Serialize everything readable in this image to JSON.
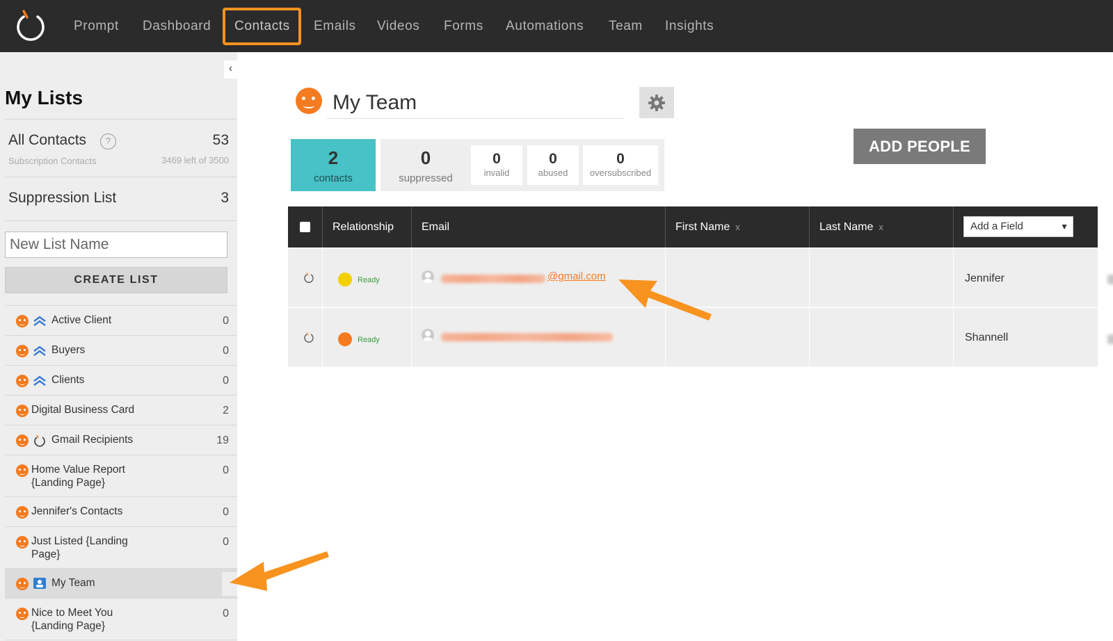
{
  "nav": {
    "items": [
      "Prompt",
      "Dashboard",
      "Contacts",
      "Emails",
      "Videos",
      "Forms",
      "Automations",
      "Team",
      "Insights"
    ],
    "active": "Contacts"
  },
  "sidebar": {
    "collapse_glyph": "‹",
    "heading": "My Lists",
    "all_contacts": {
      "label": "All Contacts",
      "count": "53",
      "sub_label": "Subscription Contacts",
      "sub_value": "3469 left of 3500"
    },
    "help_glyph": "?",
    "suppression": {
      "label": "Suppression List",
      "count": "3"
    },
    "new_list_placeholder": "New List Name",
    "create_button": "CREATE LIST",
    "lists": [
      {
        "label": "Active Client",
        "count": "0",
        "icon": "chevrons-up-icon"
      },
      {
        "label": "Buyers",
        "count": "0",
        "icon": "chevrons-up-icon"
      },
      {
        "label": "Clients",
        "count": "0",
        "icon": "chevrons-up-icon"
      },
      {
        "label": "Digital Business Card",
        "count": "2",
        "icon": ""
      },
      {
        "label": "Gmail Recipients",
        "count": "19",
        "icon": "refresh-icon"
      },
      {
        "label": "Home Value Report {Landing Page}",
        "count": "0",
        "icon": ""
      },
      {
        "label": "Jennifer's Contacts",
        "count": "0",
        "icon": ""
      },
      {
        "label": "Just Listed {Landing Page}",
        "count": "0",
        "icon": ""
      },
      {
        "label": "My Team",
        "count": "",
        "icon": "team-icon"
      },
      {
        "label": "Nice to Meet You {Landing Page}",
        "count": "0",
        "icon": ""
      }
    ]
  },
  "main": {
    "title": "My Team",
    "stats": {
      "contacts": {
        "value": "2",
        "label": "contacts"
      },
      "suppressed": {
        "value": "0",
        "label": "suppressed"
      },
      "invalid": {
        "value": "0",
        "label": "invalid"
      },
      "abused": {
        "value": "0",
        "label": "abused"
      },
      "oversubscribed": {
        "value": "0",
        "label": "oversubscribed"
      }
    },
    "add_people": "ADD PEOPLE",
    "table": {
      "headers": {
        "relationship": "Relationship",
        "email": "Email",
        "first_name": "First Name",
        "last_name": "Last Name"
      },
      "remove_glyph": "x",
      "add_field": "Add a Field",
      "rows": [
        {
          "status": "Ready",
          "email_suffix": "@gmail.com",
          "first_name": "Jennifer"
        },
        {
          "status": "Ready",
          "email_suffix": "",
          "first_name": "Shannell"
        }
      ]
    }
  },
  "colors": {
    "accent": "#f47b20",
    "teal": "#47c2c6",
    "highlight": "#f7931e",
    "nav_bg": "#2b2b2b"
  }
}
